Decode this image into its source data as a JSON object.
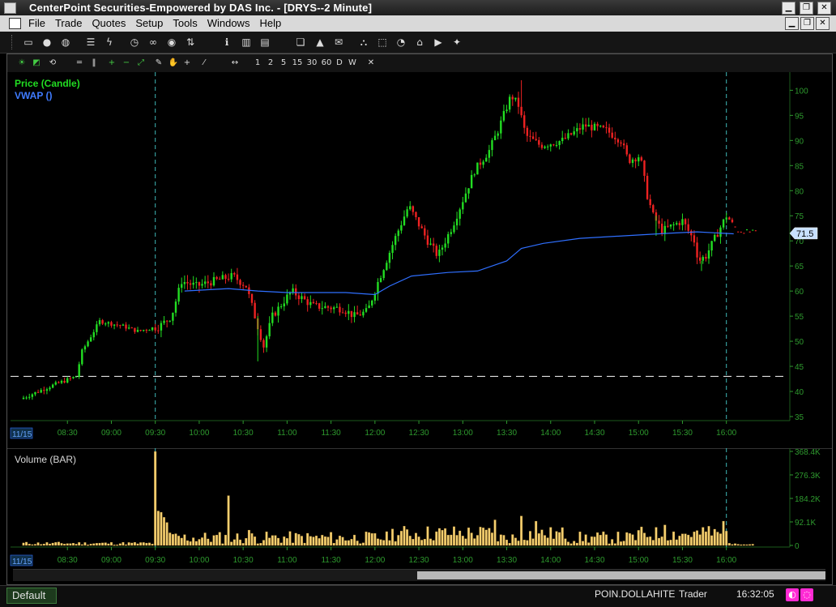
{
  "window": {
    "title": "CenterPoint Securities-Empowered by DAS Inc. - [DRYS--2 Minute]"
  },
  "menu": {
    "items": [
      "File",
      "Trade",
      "Quotes",
      "Setup",
      "Tools",
      "Windows",
      "Help"
    ]
  },
  "toolbar2": {
    "labels": [
      "1",
      "2",
      "5",
      "15",
      "30",
      "60",
      "D",
      "W"
    ]
  },
  "price_panel": {
    "title": "Price (Candle)",
    "vwap_label": "VWAP ()",
    "last_price": "71.5"
  },
  "volume_panel": {
    "title": "Volume (BAR)"
  },
  "colors": {
    "up": "#22dd22",
    "down": "#ee2222",
    "vwap": "#2f6fff",
    "volume": "#f5d070",
    "axis": "#2e9a2e",
    "divider": "#3fb8b8"
  },
  "icons": [
    "calendar-icon",
    "user-icon",
    "globe-icon",
    "list-icon",
    "flash-icon",
    "clock-icon",
    "link-icon",
    "eye-icon",
    "sort-icon",
    "info-icon",
    "chart-icon",
    "news-icon",
    "copy-icon",
    "alert-icon",
    "mail-icon",
    "network-icon",
    "select-icon",
    "timer-icon",
    "home-icon",
    "youtube-icon",
    "twitter-icon"
  ],
  "chart_data": [
    {
      "type": "candlestick",
      "title": "Price (Candle)",
      "series": [
        {
          "name": "Price (Candle)"
        },
        {
          "name": "VWAP ()"
        }
      ],
      "date": "11/15",
      "ylim": [
        35,
        102
      ],
      "yticks": [
        35,
        40,
        45,
        50,
        55,
        60,
        65,
        70,
        75,
        80,
        85,
        90,
        95,
        100
      ],
      "xticks": [
        "08:30",
        "09:00",
        "09:30",
        "10:00",
        "10:30",
        "11:00",
        "11:30",
        "12:00",
        "12:30",
        "13:00",
        "13:30",
        "14:00",
        "14:30",
        "15:00",
        "15:30",
        "16:00"
      ],
      "reference_line": 43,
      "last_price": 71.5,
      "x_minutes": [
        480,
        1000
      ],
      "price_path": [
        [
          480,
          38.5
        ],
        [
          500,
          41
        ],
        [
          518,
          43
        ],
        [
          522,
          48
        ],
        [
          534,
          54
        ],
        [
          550,
          53
        ],
        [
          560,
          52
        ],
        [
          575,
          53
        ],
        [
          583,
          55
        ],
        [
          590,
          62
        ],
        [
          600,
          61
        ],
        [
          612,
          62
        ],
        [
          625,
          63
        ],
        [
          634,
          61
        ],
        [
          640,
          55
        ],
        [
          646,
          49
        ],
        [
          652,
          55
        ],
        [
          665,
          60
        ],
        [
          680,
          57
        ],
        [
          700,
          56.5
        ],
        [
          708,
          55
        ],
        [
          717,
          56
        ],
        [
          723,
          61
        ],
        [
          735,
          70
        ],
        [
          745,
          77
        ],
        [
          758,
          70
        ],
        [
          765,
          67
        ],
        [
          775,
          73
        ],
        [
          790,
          84
        ],
        [
          800,
          88
        ],
        [
          806,
          92
        ],
        [
          815,
          99
        ],
        [
          820,
          97
        ],
        [
          825,
          91
        ],
        [
          835,
          89
        ],
        [
          850,
          90
        ],
        [
          865,
          93
        ],
        [
          880,
          92
        ],
        [
          890,
          90
        ],
        [
          895,
          86
        ],
        [
          903,
          87
        ],
        [
          908,
          79
        ],
        [
          912,
          75
        ],
        [
          918,
          72
        ],
        [
          925,
          73
        ],
        [
          932,
          74
        ],
        [
          940,
          70
        ],
        [
          943,
          66
        ],
        [
          948,
          67
        ],
        [
          955,
          71
        ],
        [
          962,
          75
        ],
        [
          970,
          72
        ],
        [
          990,
          71.5
        ]
      ],
      "vwap_path": [
        [
          590,
          60
        ],
        [
          620,
          60.5
        ],
        [
          640,
          60
        ],
        [
          660,
          59.7
        ],
        [
          700,
          59.7
        ],
        [
          720,
          59.3
        ],
        [
          730,
          61
        ],
        [
          745,
          63
        ],
        [
          770,
          63.7
        ],
        [
          790,
          64
        ],
        [
          810,
          66
        ],
        [
          820,
          68.5
        ],
        [
          835,
          69.5
        ],
        [
          860,
          70.5
        ],
        [
          890,
          71
        ],
        [
          920,
          71.5
        ],
        [
          940,
          71.8
        ],
        [
          965,
          71.4
        ]
      ]
    },
    {
      "type": "bar",
      "title": "Volume (BAR)",
      "series": [
        {
          "name": "Volume (BAR)"
        }
      ],
      "ylim": [
        0,
        368400
      ],
      "yticks": [
        "0",
        "92.1K",
        "184.2K",
        "276.3K",
        "368.4K"
      ],
      "xticks": [
        "08:30",
        "09:00",
        "09:30",
        "10:00",
        "10:30",
        "11:00",
        "11:30",
        "12:00",
        "12:30",
        "13:00",
        "13:30",
        "14:00",
        "14:30",
        "15:00",
        "15:30",
        "16:00"
      ],
      "spikes": [
        [
          570,
          368000
        ],
        [
          572,
          135000
        ],
        [
          574,
          130000
        ],
        [
          576,
          110000
        ],
        [
          578,
          90000
        ],
        [
          620,
          195000
        ],
        [
          634,
          60000
        ],
        [
          775,
          120000
        ],
        [
          793,
          92000
        ],
        [
          802,
          100000
        ],
        [
          820,
          115000
        ],
        [
          830,
          95000
        ],
        [
          865,
          70000
        ],
        [
          875,
          65000
        ],
        [
          905,
          85000
        ],
        [
          918,
          80000
        ],
        [
          948,
          75000
        ],
        [
          958,
          95000
        ]
      ]
    }
  ]
}
